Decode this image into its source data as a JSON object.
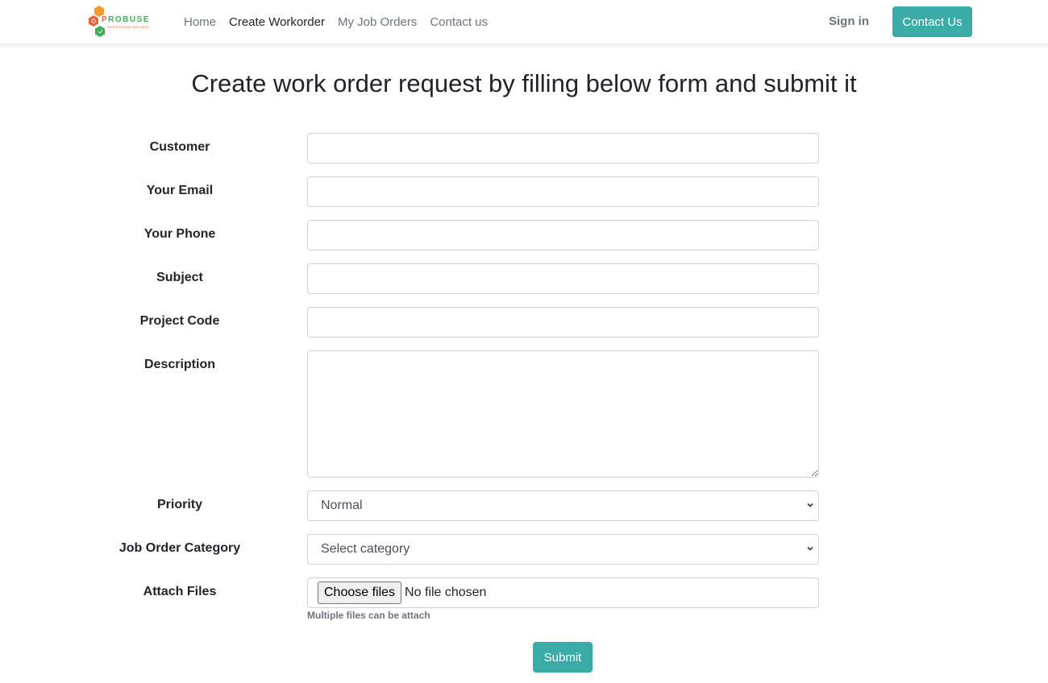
{
  "brand": {
    "logo_main_first": "P",
    "logo_main_rest": "ROBUSE",
    "logo_sub": "PROFESSIONAL BUSINESS",
    "accent_color": "#3aaba6"
  },
  "nav": {
    "links": [
      {
        "label": "Home",
        "active": false
      },
      {
        "label": "Create Workorder",
        "active": true
      },
      {
        "label": "My Job Orders",
        "active": false
      },
      {
        "label": "Contact us",
        "active": false
      }
    ],
    "sign_in": "Sign in",
    "contact_button": "Contact Us"
  },
  "page": {
    "title": "Create work order request by filling below form and submit it"
  },
  "form": {
    "customer": {
      "label": "Customer",
      "value": ""
    },
    "email": {
      "label": "Your Email",
      "value": ""
    },
    "phone": {
      "label": "Your Phone",
      "value": ""
    },
    "subject": {
      "label": "Subject",
      "value": ""
    },
    "project_code": {
      "label": "Project Code",
      "value": ""
    },
    "description": {
      "label": "Description",
      "value": ""
    },
    "priority": {
      "label": "Priority",
      "selected": "Normal"
    },
    "category": {
      "label": "Job Order Category",
      "selected": "Select category"
    },
    "attach": {
      "label": "Attach Files",
      "button": "Choose files",
      "status": "No file chosen",
      "help": "Multiple files can be attach"
    },
    "submit": "Submit"
  }
}
